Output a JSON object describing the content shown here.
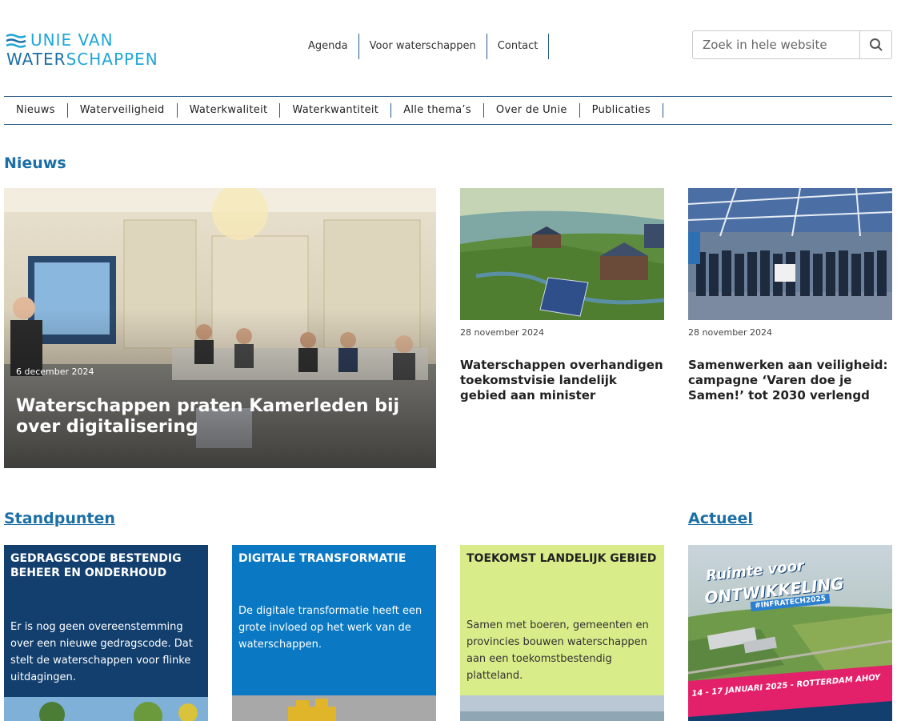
{
  "logo": {
    "line1": "UNIE VAN",
    "line2a": "WATER",
    "line2b": "SCHAPPEN"
  },
  "topnav": [
    "Agenda",
    "Voor waterschappen",
    "Contact"
  ],
  "search": {
    "placeholder": "Zoek in hele website"
  },
  "mainnav": [
    "Nieuws",
    "Waterveiligheid",
    "Waterkwaliteit",
    "Waterkwantiteit",
    "Alle thema’s",
    "Over de Unie",
    "Publicaties"
  ],
  "news": {
    "title": "Nieuws",
    "feature": {
      "date": "6 december 2024",
      "title": "Waterschappen praten Kamerleden bij over digitalisering"
    },
    "items": [
      {
        "date": "28 november 2024",
        "title": "Waterschappen overhandigen toekomstvisie landelijk gebied aan minister"
      },
      {
        "date": "28 november 2024",
        "title": "Samenwerken aan veiligheid: campagne ‘Varen doe je Samen!’ tot 2030 verlengd"
      }
    ]
  },
  "standpunten": {
    "title": "Standpunten",
    "tiles": [
      {
        "head": "GEDRAGSCODE BESTENDIG BEHEER EN ONDERHOUD",
        "body": "Er is nog geen overeenstemming over een nieuwe gedragscode. Dat stelt de waterschappen voor flinke uitdagingen."
      },
      {
        "head": "DIGITALE TRANSFORMATIE",
        "body": "De digitale transformatie heeft een grote invloed op het werk van de waterschappen."
      },
      {
        "head": "TOEKOMST LANDELIJK GEBIED",
        "body": "Samen met boeren, gemeenten en provincies bouwen waterschappen aan een toekomstbestendig platteland."
      }
    ]
  },
  "actueel": {
    "title": "Actueel",
    "banner_line1": "Ruimte voor",
    "banner_line2": "ONTWIKKELING",
    "banner_tag": "#INFRATECH2025",
    "banner_date": "14 - 17 JANUARI 2025 - ROTTERDAM AHOY"
  },
  "colors": {
    "brand_blue": "#1b6fa6",
    "brand_light_blue": "#1fa5d8",
    "tile_dark_blue": "#123f6e",
    "tile_blue": "#0a78c2",
    "tile_green": "#d8ec8a",
    "banner_pink": "#e3206a"
  }
}
